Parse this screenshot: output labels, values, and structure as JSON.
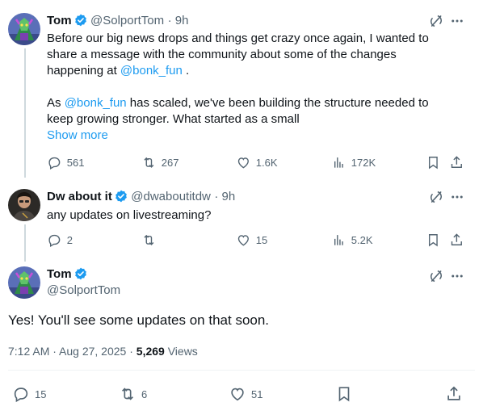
{
  "tweets": [
    {
      "name": "Tom",
      "handle": "@SolportTom",
      "time": "· 9h",
      "line1": "Before our big news drops and things get crazy once again, I wanted to",
      "line2": "share a message with the community about some of the changes",
      "line3_pre": "happening at ",
      "line3_mention": "@bonk_fun",
      "line3_post": " .",
      "para2_pre": "As ",
      "para2_mention": "@bonk_fun",
      "para2_post": "  has scaled, we've been building the structure needed to",
      "para2_line2": "keep growing stronger. What started as a small",
      "show_more": "Show more",
      "replies": "561",
      "retweets": "267",
      "likes": "1.6K",
      "views": "172K"
    },
    {
      "name": "Dw about it",
      "handle": "@dwaboutitdw",
      "time": "· 9h",
      "text": "any updates on livestreaming?",
      "replies": "2",
      "retweets": "",
      "likes": "15",
      "views": "5.2K"
    }
  ],
  "main": {
    "name": "Tom",
    "handle": "@SolportTom",
    "text": "Yes! You'll see some updates on that soon.",
    "timestamp": "7:12 AM · Aug 27, 2025 · ",
    "views_count": "5,269",
    "views_label": " Views",
    "replies": "15",
    "retweets": "6",
    "likes": "51"
  },
  "colors": {
    "accent": "#1d9bf0",
    "muted": "#536471",
    "text": "#0f1419",
    "divider": "#eff3f4"
  }
}
